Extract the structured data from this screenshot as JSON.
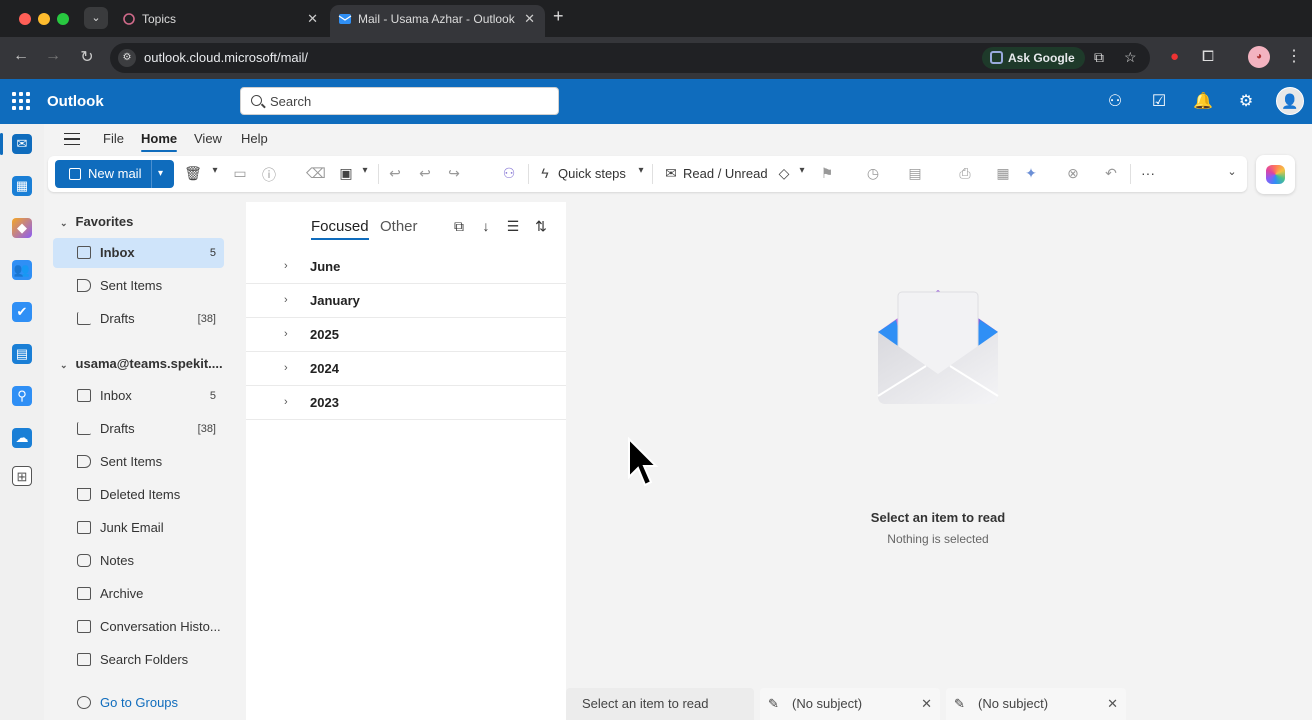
{
  "browser": {
    "tabs": [
      {
        "label": "Topics",
        "close": "✕"
      },
      {
        "label": "Mail - Usama Azhar - Outlook",
        "close": "✕"
      }
    ],
    "new_tab": "+",
    "url": "outlook.cloud.microsoft/mail/",
    "ask_google": "Ask Google"
  },
  "header": {
    "app_name": "Outlook",
    "search_placeholder": "Search"
  },
  "ribbon": {
    "tabs": [
      "File",
      "Home",
      "View",
      "Help"
    ],
    "new_mail": "New mail",
    "quick_steps": "Quick steps",
    "read_unread": "Read / Unread",
    "more": "···"
  },
  "favorites": {
    "heading": "Favorites",
    "items": [
      {
        "label": "Inbox",
        "count": "5"
      },
      {
        "label": "Sent Items",
        "count": ""
      },
      {
        "label": "Drafts",
        "count": "[38]"
      }
    ]
  },
  "account": {
    "heading": "usama@teams.spekit....",
    "items": [
      {
        "label": "Inbox",
        "count": "5"
      },
      {
        "label": "Drafts",
        "count": "[38]"
      },
      {
        "label": "Sent Items",
        "count": ""
      },
      {
        "label": "Deleted Items",
        "count": ""
      },
      {
        "label": "Junk Email",
        "count": ""
      },
      {
        "label": "Notes",
        "count": ""
      },
      {
        "label": "Archive",
        "count": ""
      },
      {
        "label": "Conversation Histo...",
        "count": ""
      },
      {
        "label": "Search Folders",
        "count": ""
      }
    ],
    "go_to_groups": "Go to Groups"
  },
  "mail_list": {
    "pivots": [
      "Focused",
      "Other"
    ],
    "groups": [
      "June",
      "January",
      "2025",
      "2024",
      "2023"
    ]
  },
  "reading_pane": {
    "title": "Select an item to read",
    "subtitle": "Nothing is selected"
  },
  "bottom_tabs": [
    "Select an item to read",
    "(No subject)",
    "(No subject)"
  ],
  "colors": {
    "brand": "#0f6cbd",
    "selected": "#cfe4fa"
  }
}
